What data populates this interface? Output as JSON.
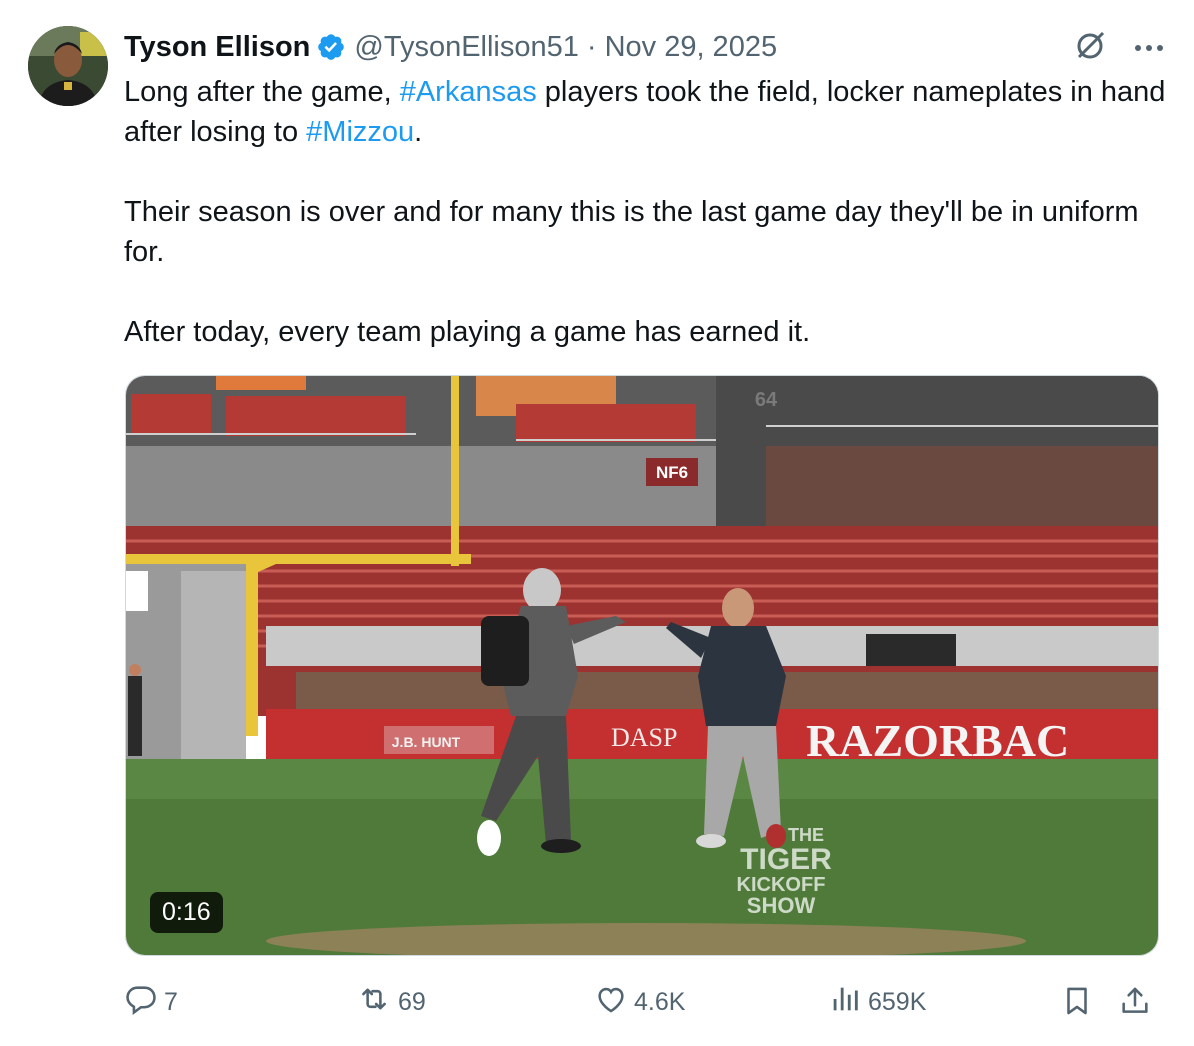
{
  "tweet": {
    "author_name": "Tyson Ellison",
    "handle": "@TysonEllison51",
    "separator": "·",
    "date": "Nov 29, 2025",
    "text_lines": [
      "Long after the game, ",
      "#Arkansas",
      " players took the field, locker nameplates in hand after losing to ",
      "#Mizzou",
      ".",
      "Their season is over and for many this is the last game day they'll be in uniform for.",
      "After today, every team playing a game has earned it."
    ],
    "more_label": "•••"
  },
  "media": {
    "duration": "0:16",
    "stadium_signs": {
      "nf6": "NF6",
      "section": "64",
      "jb_hunt": "J.B. HUNT",
      "dasp": "DASP",
      "razorback": "RAZORBAC"
    },
    "watermark": [
      "THE",
      "TIGER",
      "KICKOFF",
      "SHOW"
    ]
  },
  "actions": {
    "replies": "7",
    "reposts": "69",
    "likes": "4.6K",
    "views": "659K"
  },
  "colors": {
    "link": "#1d9bf0",
    "muted": "#536471",
    "verified": "#1d9bf0",
    "seat_red": "#b43a36",
    "field_green": "#4f7a3a"
  },
  "icons": [
    "verified-badge-icon",
    "grok-icon",
    "more-icon",
    "reply-icon",
    "repost-icon",
    "like-icon",
    "views-icon",
    "bookmark-icon",
    "share-icon"
  ]
}
